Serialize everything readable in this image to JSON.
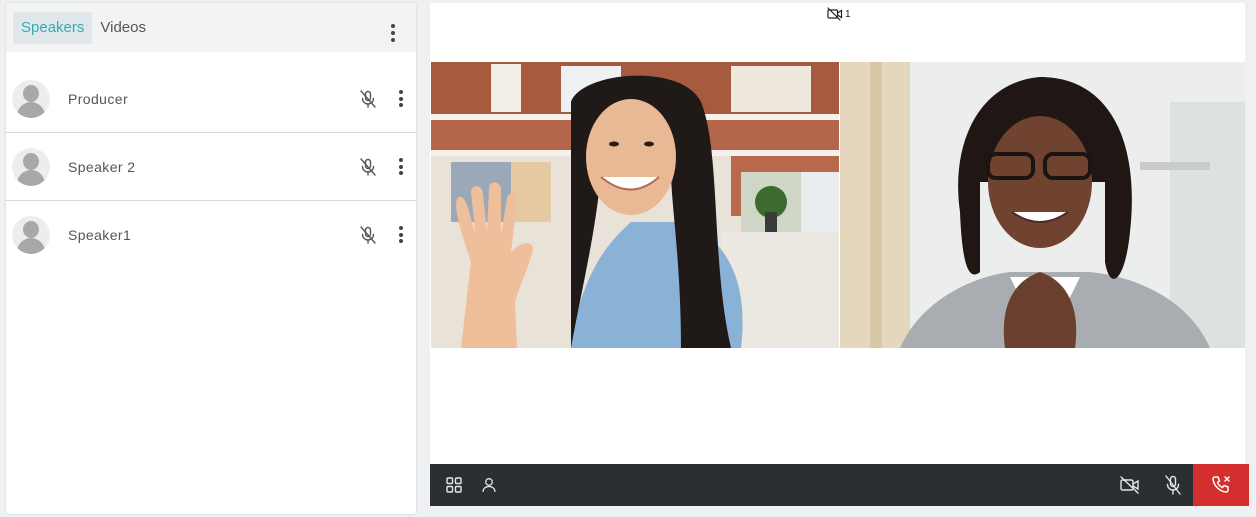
{
  "tabs": [
    {
      "label": "Speakers",
      "active": true
    },
    {
      "label": "Videos",
      "active": false
    }
  ],
  "speakers": [
    {
      "name": "Producer",
      "mic": "muted"
    },
    {
      "name": "Speaker 2",
      "mic": "muted"
    },
    {
      "name": "Speaker1",
      "mic": "muted"
    }
  ],
  "stage": {
    "camera_count": "1"
  },
  "colors": {
    "accent": "#3aa9b5",
    "control_bar": "#2b2f33",
    "hangup": "#d32f2f"
  },
  "icons": {
    "panel_menu": "more-vertical-icon",
    "mic_muted": "mic-off-icon",
    "camera_off": "video-off-icon",
    "layout": "grid-icon",
    "person": "person-icon",
    "hangup": "phone-hangup-icon"
  }
}
